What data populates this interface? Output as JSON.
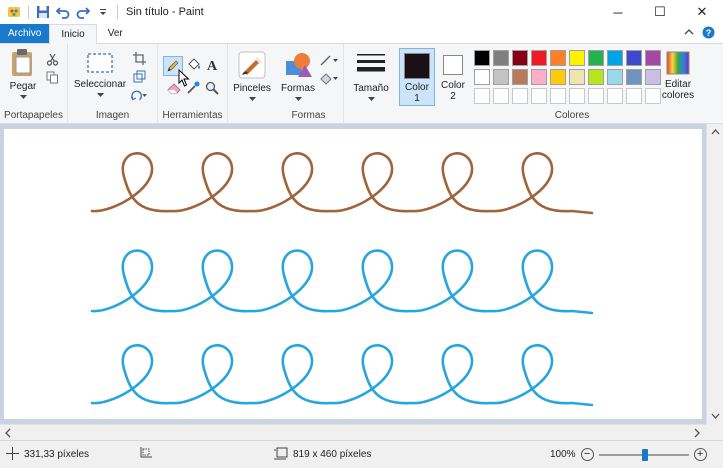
{
  "window": {
    "title": "Sin título - Paint",
    "minimize_glyph": "─",
    "maximize_glyph": "☐",
    "close_glyph": "✕"
  },
  "tabs": {
    "file": "Archivo",
    "home": "Inicio",
    "view": "Ver"
  },
  "ribbon": {
    "clipboard": {
      "paste": "Pegar",
      "group": "Portapapeles"
    },
    "image": {
      "select": "Seleccionar",
      "group": "Imagen"
    },
    "tools": {
      "group": "Herramientas",
      "text_glyph": "A"
    },
    "brushes": {
      "label": "Pinceles"
    },
    "shapes": {
      "label": "Formas",
      "group": "Formas"
    },
    "size": {
      "label": "Tamaño"
    },
    "color1": {
      "label": "Color",
      "number": "1"
    },
    "color2": {
      "label": "Color",
      "number": "2"
    },
    "colors": {
      "group": "Colores",
      "edit": "Editar colores",
      "edit_line1": "Editar",
      "edit_line2": "colores",
      "row1": [
        "#000000",
        "#7f7f7f",
        "#880015",
        "#ed1c24",
        "#ff7f27",
        "#fff200",
        "#22b14c",
        "#00a2e8",
        "#3f48cc",
        "#a349a4"
      ],
      "row2": [
        "#ffffff",
        "#c3c3c3",
        "#b97a57",
        "#ffaec9",
        "#ffc90e",
        "#efe4b0",
        "#b5e61d",
        "#99d9ea",
        "#7092be",
        "#c8bfe7"
      ]
    }
  },
  "canvas": {
    "stroke_colors": {
      "top": "#a0643c",
      "middle": "#27a5df",
      "bottom": "#27a5df"
    }
  },
  "status": {
    "cursor_pos": "331,33 píxeles",
    "image_size": "819 x 460 píxeles",
    "zoom": "100%",
    "zoom_out": "−",
    "zoom_in": "+"
  }
}
